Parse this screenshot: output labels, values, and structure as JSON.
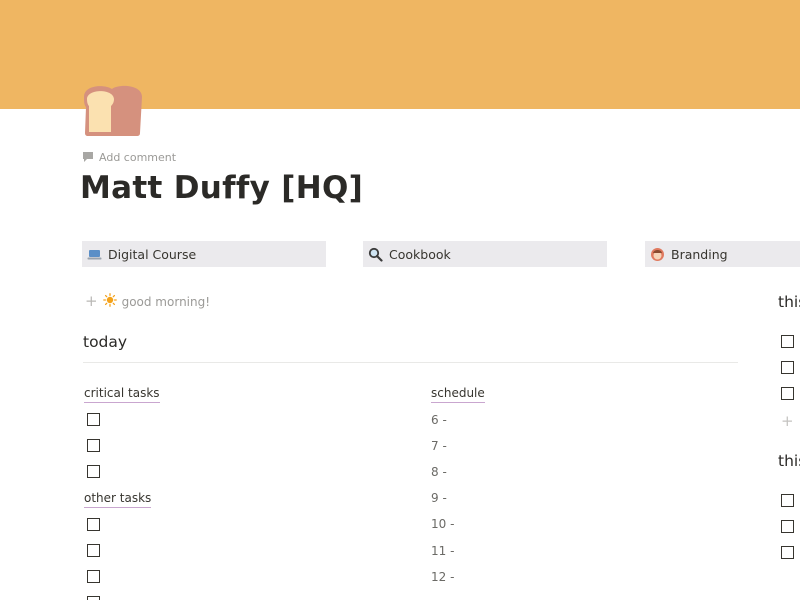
{
  "page": {
    "icon": "bread-icon",
    "add_comment": "Add comment",
    "title": "Matt Duffy [HQ]"
  },
  "links": [
    {
      "label": "Digital Course",
      "icon": "laptop-icon"
    },
    {
      "label": "Cookbook",
      "icon": "magnifier-icon"
    },
    {
      "label": "Branding",
      "icon": "avatar-icon"
    }
  ],
  "greeting": {
    "text": "good morning!",
    "icon": "sun-icon"
  },
  "today": {
    "heading": "today",
    "critical_heading": "critical tasks",
    "other_heading": "other tasks",
    "schedule_heading": "schedule",
    "schedule": [
      "6 -",
      "7 -",
      "8 -",
      "9 -",
      "10 -",
      "11 -",
      "12 -"
    ]
  },
  "right_column": {
    "heading_1": "this week",
    "heading_2": "this month"
  },
  "colors": {
    "cover": "#efb662",
    "card_bg": "#ebeaed",
    "heading_underline": "#c9a6cf"
  }
}
